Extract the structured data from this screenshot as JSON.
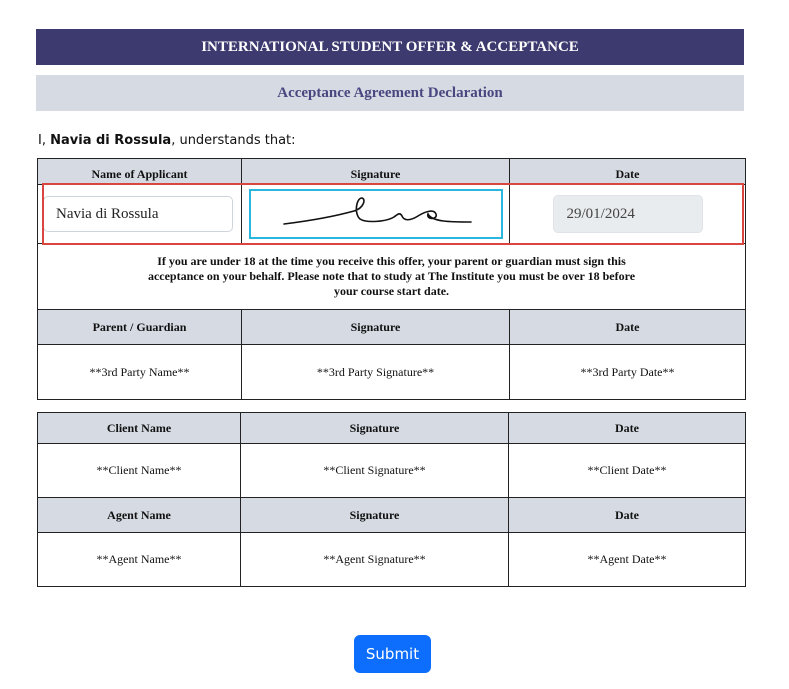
{
  "header": {
    "title": "INTERNATIONAL STUDENT OFFER & ACCEPTANCE",
    "subtitle": "Acceptance Agreement Declaration"
  },
  "intro": {
    "prefix": "I, ",
    "name": "Navia di Rossula",
    "suffix": ", understands that:"
  },
  "applicant_table": {
    "headers": [
      "Name of Applicant",
      "Signature",
      "Date"
    ],
    "name_value": "Navia di Rossula",
    "signature_icon": "handwritten-signature",
    "date_value": "29/01/2024",
    "notice": "If you are under 18 at the time you receive this offer, your parent or guardian must sign this acceptance on your behalf. Please note that to study at The Institute you must be over 18 before your course start date.",
    "guardian_headers": [
      "Parent / Guardian",
      "Signature",
      "Date"
    ],
    "guardian_values": [
      "**3rd Party Name**",
      "**3rd Party Signature**",
      "**3rd Party Date**"
    ]
  },
  "client_table": {
    "client_headers": [
      "Client Name",
      "Signature",
      "Date"
    ],
    "client_values": [
      "**Client Name**",
      "**Client Signature**",
      "**Client Date**"
    ],
    "agent_headers": [
      "Agent Name",
      "Signature",
      "Date"
    ],
    "agent_values": [
      "**Agent Name**",
      "**Agent Signature**",
      "**Agent Date**"
    ]
  },
  "actions": {
    "submit_label": "Submit"
  },
  "colors": {
    "title_bg": "#3c3a6e",
    "subtitle_bg": "#d6dbe3",
    "highlight": "#d9463f",
    "signature_border": "#29b6e0",
    "submit_bg": "#0d6efd"
  }
}
